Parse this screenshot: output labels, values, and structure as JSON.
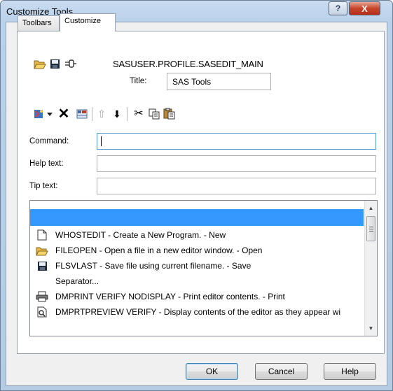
{
  "window": {
    "title": "Customize Tools",
    "help_glyph": "?",
    "close_glyph": "X"
  },
  "tabs": [
    {
      "label": "Toolbars",
      "active": false
    },
    {
      "label": "Customize",
      "active": true
    }
  ],
  "profile": {
    "name": "SASUSER.PROFILE.SASEDIT_MAIN",
    "title_label": "Title:",
    "title_value": "SAS Tools",
    "icons": [
      "open-folder-icon",
      "save-icon",
      "plug-icon"
    ]
  },
  "edit_toolbar": {
    "icons": [
      "add-tool-icon",
      "dropdown-arrow-icon",
      "delete-icon",
      "grid-icon",
      "move-up-icon",
      "move-down-icon",
      "cut-icon",
      "copy-icon",
      "paste-icon"
    ],
    "delete_glyph": "✕",
    "up_glyph": "⇧",
    "down_glyph": "⬇",
    "cut_glyph": "✂"
  },
  "fields": {
    "command_label": "Command:",
    "command_value": "",
    "help_label": "Help text:",
    "help_value": "",
    "tip_label": "Tip text:",
    "tip_value": ""
  },
  "tools_list": {
    "items": [
      {
        "text": "",
        "icon": "",
        "selected": true
      },
      {
        "text": "WHOSTEDIT - Create a New Program. - New",
        "icon": "new-document-icon",
        "selected": false
      },
      {
        "text": "FILEOPEN - Open a file in a new editor window. - Open",
        "icon": "open-folder-icon",
        "selected": false
      },
      {
        "text": "FLSVLAST - Save file using current filename. - Save",
        "icon": "save-icon",
        "selected": false
      },
      {
        "text": "Separator...",
        "icon": "",
        "selected": false
      },
      {
        "text": "DMPRINT VERIFY NODISPLAY - Print editor contents. - Print",
        "icon": "printer-icon",
        "selected": false
      },
      {
        "text": "DMPRTPREVIEW VERIFY - Display contents of the editor as they appear wi",
        "icon": "print-preview-icon",
        "selected": false
      }
    ],
    "scroll_up_glyph": "▲",
    "scroll_down_glyph": "▼"
  },
  "buttons": {
    "ok": "OK",
    "cancel": "Cancel",
    "help": "Help"
  },
  "colors": {
    "selection": "#3399ff",
    "close_button": "#c7442b",
    "title_bar": "#b9d1ea"
  }
}
